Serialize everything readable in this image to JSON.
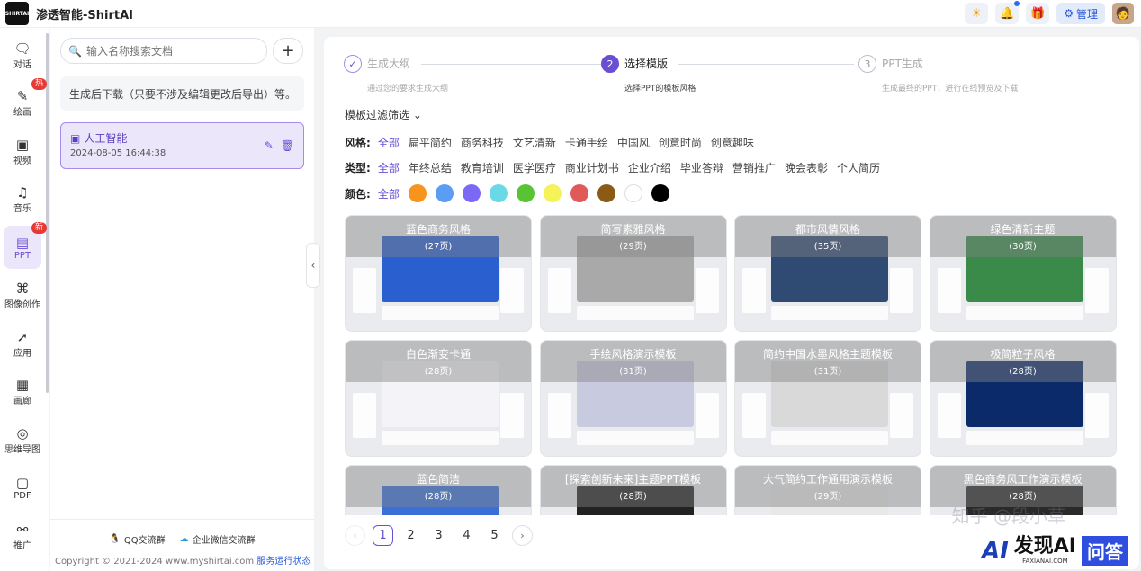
{
  "app": {
    "title": "渗透智能-ShirtAI",
    "logo_text": "SHIRTAI"
  },
  "topbar": {
    "admin_label": "管理"
  },
  "sidebar": {
    "items": [
      {
        "label": "对话",
        "icon": "chat-icon",
        "glyph": "🗨"
      },
      {
        "label": "绘画",
        "icon": "paint-icon",
        "glyph": "✎",
        "badge": "热"
      },
      {
        "label": "视频",
        "icon": "video-icon",
        "glyph": "▣"
      },
      {
        "label": "音乐",
        "icon": "music-icon",
        "glyph": "♫"
      },
      {
        "label": "PPT",
        "icon": "ppt-icon",
        "glyph": "▤",
        "badge": "新",
        "active": true
      },
      {
        "label": "图像创作",
        "icon": "image-create-icon",
        "glyph": "⌘"
      },
      {
        "label": "应用",
        "icon": "rocket-icon",
        "glyph": "➚"
      },
      {
        "label": "画廊",
        "icon": "gallery-icon",
        "glyph": "▦"
      },
      {
        "label": "思维导图",
        "icon": "mindmap-icon",
        "glyph": "◎"
      },
      {
        "label": "PDF",
        "icon": "pdf-icon",
        "glyph": "▢"
      },
      {
        "label": "推广",
        "icon": "handshake-icon",
        "glyph": "⚯"
      }
    ]
  },
  "docs": {
    "search_placeholder": "输入名称搜索文档",
    "notice": "生成后下载（只要不涉及编辑更改后导出）等。",
    "items": [
      {
        "name": "人工智能",
        "date": "2024-08-05 16:44:38"
      }
    ]
  },
  "footer": {
    "qq_label": "QQ交流群",
    "wechat_label": "企业微信交流群",
    "copyright": "Copyright © 2021-2024 www.myshirtai.com",
    "status_link": "服务运行状态"
  },
  "steps": [
    {
      "num": "✓",
      "title": "生成大纲",
      "desc": "通过您的要求生成大纲"
    },
    {
      "num": "2",
      "title": "选择模版",
      "desc": "选择PPT的模板风格",
      "active": true
    },
    {
      "num": "3",
      "title": "PPT生成",
      "desc": "生成最终的PPT，进行在线预览及下载"
    }
  ],
  "filter": {
    "header": "模板过滤筛选",
    "style_label": "风格:",
    "styles": [
      "全部",
      "扁平简约",
      "商务科技",
      "文艺清新",
      "卡通手绘",
      "中国风",
      "创意时尚",
      "创意趣味"
    ],
    "type_label": "类型:",
    "types": [
      "全部",
      "年终总结",
      "教育培训",
      "医学医疗",
      "商业计划书",
      "企业介绍",
      "毕业答辩",
      "营销推广",
      "晚会表彰",
      "个人简历"
    ],
    "color_label": "颜色:",
    "color_all": "全部",
    "colors": [
      "#f7941d",
      "#5b9cf5",
      "#7b68f5",
      "#6ad9e6",
      "#58c434",
      "#f5f25a",
      "#e05a5a",
      "#8b5a14",
      "#ffffff",
      "#000000"
    ]
  },
  "templates": [
    {
      "title": "蓝色商务风格",
      "pages": "(27页)",
      "color": "#2a5fd0"
    },
    {
      "title": "简写素雅风格",
      "pages": "(29页)",
      "color": "#a9a9a9"
    },
    {
      "title": "都市风情风格",
      "pages": "(35页)",
      "color": "#2f4a73"
    },
    {
      "title": "绿色清新主题",
      "pages": "(30页)",
      "color": "#3a8a4a"
    },
    {
      "title": "白色渐变卡通",
      "pages": "(28页)",
      "color": "#f4f4f8"
    },
    {
      "title": "手绘风格演示模板",
      "pages": "(31页)",
      "color": "#c8cbe0"
    },
    {
      "title": "简约中国水墨风格主题模板",
      "pages": "(31页)",
      "color": "#d9d9d9"
    },
    {
      "title": "极简粒子风格",
      "pages": "(28页)",
      "color": "#0b2a6a"
    },
    {
      "title": "蓝色简洁",
      "pages": "(28页)",
      "color": "#3a6fd8"
    },
    {
      "title": "[探索创新未来]主题PPT模板",
      "pages": "(28页)",
      "color": "#222222"
    },
    {
      "title": "大气简约工作通用演示模板",
      "pages": "(29页)",
      "color": "#e8e8e8"
    },
    {
      "title": "黑色商务风工作演示模板",
      "pages": "(28页)",
      "color": "#2a2a2a"
    }
  ],
  "pager": {
    "pages": [
      "1",
      "2",
      "3",
      "4",
      "5"
    ],
    "current": "1"
  },
  "watermark": {
    "zhihu": "知乎 @段小草",
    "brand": "发现AI",
    "domain": "FAXIANAI.COM",
    "box": "问答",
    "logo": "AI"
  }
}
